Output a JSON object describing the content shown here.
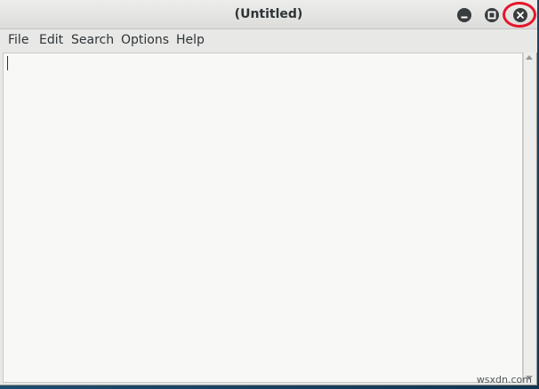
{
  "window": {
    "title": "(Untitled)"
  },
  "titlebar": {
    "minimize_icon": "minimize-icon",
    "maximize_icon": "maximize-icon",
    "close_icon": "close-icon",
    "highlight_color": "#e5162b"
  },
  "menubar": {
    "items": [
      {
        "label": "File"
      },
      {
        "label": "Edit"
      },
      {
        "label": "Search"
      },
      {
        "label": "Options"
      },
      {
        "label": "Help"
      }
    ]
  },
  "editor": {
    "content": ""
  },
  "watermark": "wsxdn.com"
}
